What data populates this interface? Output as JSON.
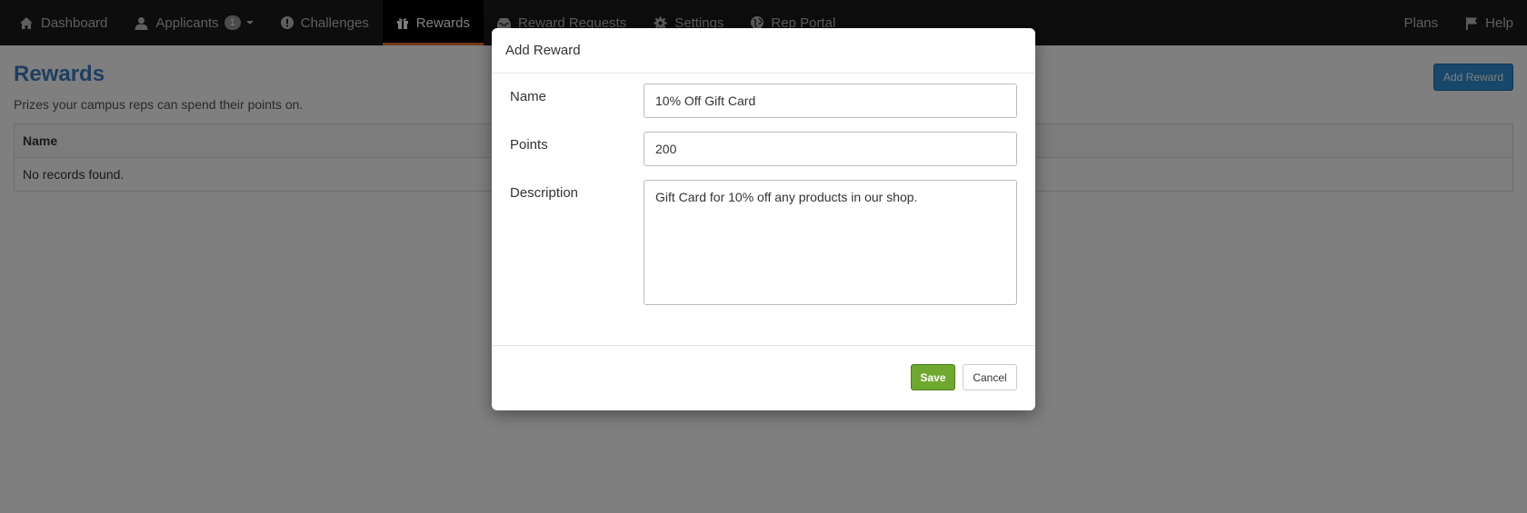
{
  "nav": {
    "left_items": [
      {
        "label": "Dashboard",
        "icon": "home-icon"
      },
      {
        "label": "Applicants",
        "icon": "user-icon",
        "badge": "1"
      },
      {
        "label": "Challenges",
        "icon": "exclamation-icon"
      },
      {
        "label": "Rewards",
        "icon": "gift-icon",
        "active": true
      },
      {
        "label": "Reward Requests",
        "icon": "inbox-icon"
      },
      {
        "label": "Settings",
        "icon": "gear-icon"
      },
      {
        "label": "Rep Portal",
        "icon": "globe-icon"
      }
    ],
    "right_items": [
      {
        "label": "Plans"
      },
      {
        "label": "Help",
        "icon": "flag-icon"
      }
    ],
    "accent_color": "#e8702a"
  },
  "page": {
    "title": "Rewards",
    "subtitle": "Prizes your campus reps can spend their points on.",
    "add_button_label": "Add Reward",
    "table": {
      "header": "Name",
      "empty_message": "No records found."
    }
  },
  "modal": {
    "title": "Add Reward",
    "fields": {
      "name_label": "Name",
      "name_value": "10% Off Gift Card",
      "points_label": "Points",
      "points_value": "200",
      "description_label": "Description",
      "description_value": "Gift Card for 10% off any products in our shop."
    },
    "save_label": "Save",
    "cancel_label": "Cancel",
    "save_color": "#6fa82f"
  }
}
